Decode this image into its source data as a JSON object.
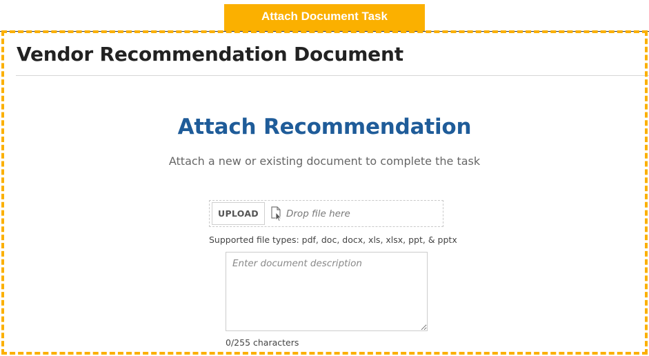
{
  "task_tab": {
    "label": "Attach Document Task"
  },
  "page": {
    "title": "Vendor Recommendation Document"
  },
  "attach": {
    "heading": "Attach Recommendation",
    "subtitle": "Attach a new or existing document to complete the task"
  },
  "dropzone": {
    "upload_label": "UPLOAD",
    "drop_text": "Drop file here",
    "icon": "file-drop-icon",
    "supported_types": "Supported file types: pdf, doc, docx, xls, xlsx, ppt, & pptx"
  },
  "description": {
    "value": "",
    "placeholder": "Enter document description",
    "char_count": "0/255 characters"
  },
  "colors": {
    "accent_orange": "#fbb000",
    "heading_blue": "#1f5c99"
  }
}
